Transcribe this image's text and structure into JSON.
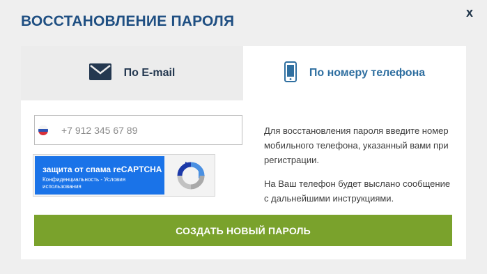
{
  "dialog": {
    "title": "ВОССТАНОВЛЕНИЕ ПАРОЛЯ",
    "close_label": "x"
  },
  "tabs": [
    {
      "label": "По E-mail",
      "icon": "envelope-icon",
      "active": false
    },
    {
      "label": "По номеру телефона",
      "icon": "mobile-phone-icon",
      "active": true
    }
  ],
  "form": {
    "phone_placeholder": "+7 912 345 67 89",
    "flag": "russia-flag-icon",
    "recaptcha": {
      "title": "защита от спама reCAPTCHA",
      "subtitle": "Конфиденциальность - Условия использования",
      "icon": "recaptcha-logo-icon"
    },
    "info_paragraph_1": "Для восстановления пароля введите номер мобильного телефона, указанный вами при регистрации.",
    "info_paragraph_2": "На Ваш телефон будет выслано сообщение с дальнейшими инструкциями.",
    "submit_label": "СОЗДАТЬ НОВЫЙ ПАРОЛЬ"
  },
  "colors": {
    "title": "#1f4f82",
    "active_tab_text": "#2f6fa0",
    "submit_button": "#7aa22c",
    "recaptcha_blue": "#1a73e8"
  }
}
